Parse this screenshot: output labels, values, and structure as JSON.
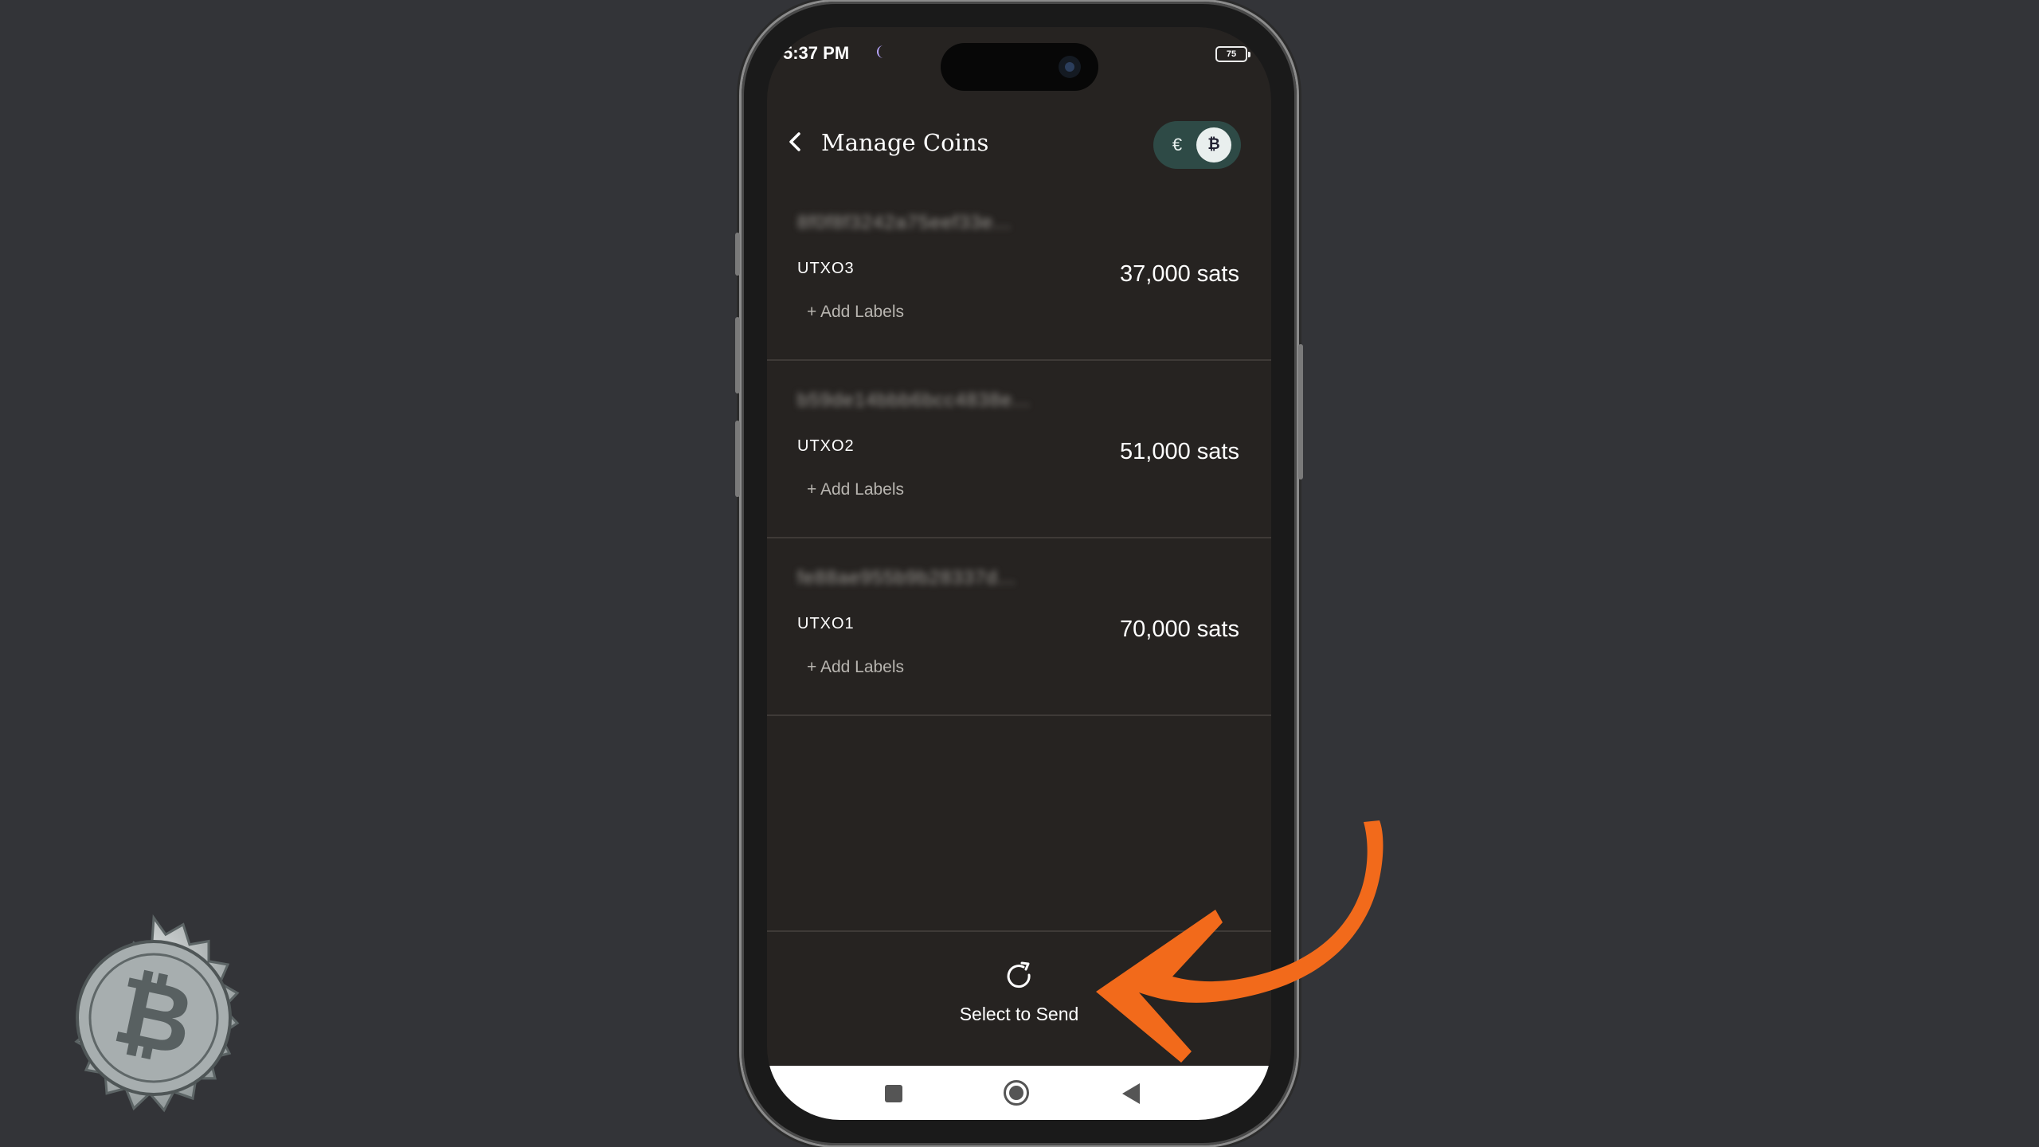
{
  "status_bar": {
    "time": "5:37 PM",
    "battery": "75"
  },
  "header": {
    "title": "Manage Coins",
    "currency_euro": "€",
    "currency_btc": "₿"
  },
  "coins": [
    {
      "txid": "8f0f8f3242a75eef33e...",
      "label": "UTXO3",
      "amount": "37,000 sats",
      "add_labels": "+ Add Labels"
    },
    {
      "txid": "b59de14bbb6bcc4838e...",
      "label": "UTXO2",
      "amount": "51,000 sats",
      "add_labels": "+ Add Labels"
    },
    {
      "txid": "fe88ae955b9b28337d...",
      "label": "UTXO1",
      "amount": "70,000 sats",
      "add_labels": "+ Add Labels"
    }
  ],
  "footer": {
    "send_label": "Select to Send"
  },
  "colors": {
    "background": "#333438",
    "screen": "#262321",
    "toggle": "#2e4a46",
    "arrow": "#f26a1b"
  }
}
